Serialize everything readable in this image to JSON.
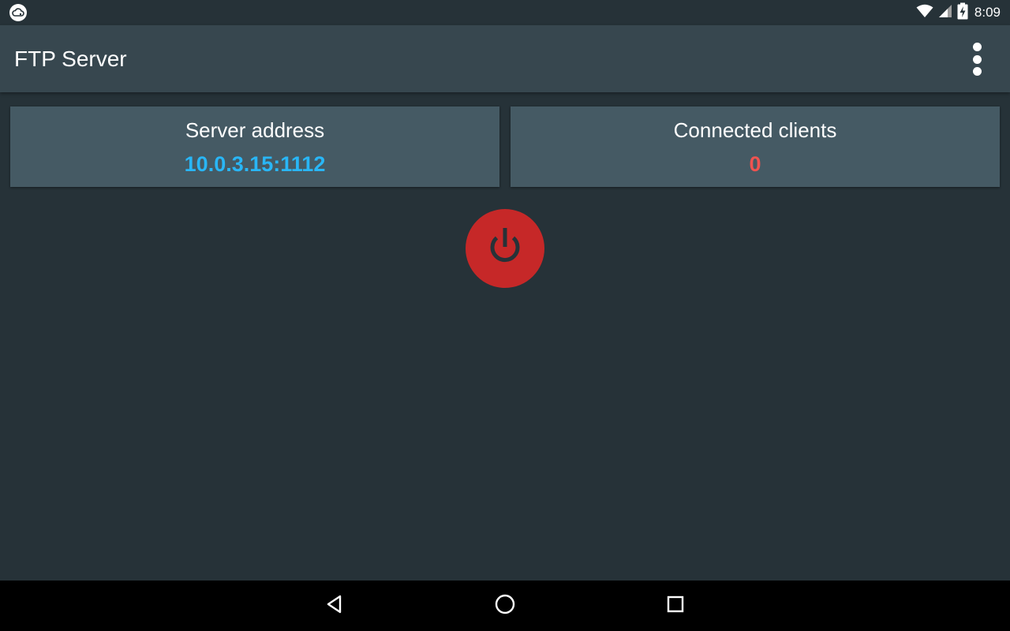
{
  "status_bar": {
    "time": "8:09",
    "icons": [
      "cloud-notification-icon",
      "wifi-icon",
      "cell-signal-icon",
      "battery-charging-icon"
    ]
  },
  "app_bar": {
    "title": "FTP Server",
    "menu_icon": "overflow-menu-icon"
  },
  "cards": {
    "server_address": {
      "title": "Server address",
      "value": "10.0.3.15:1112"
    },
    "connected_clients": {
      "title": "Connected clients",
      "value": "0"
    }
  },
  "power_button": {
    "icon": "power-icon",
    "state": "off"
  },
  "nav_bar": {
    "buttons": [
      "back-icon",
      "home-icon",
      "recents-icon"
    ]
  },
  "colors": {
    "background": "#263238",
    "app_bar": "#37474f",
    "card": "#455a64",
    "address_value": "#29b6f6",
    "clients_value": "#ef5350",
    "power_button": "#c62828"
  }
}
